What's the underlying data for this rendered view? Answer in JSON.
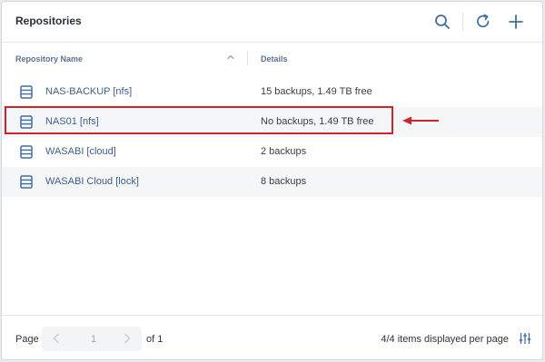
{
  "header": {
    "title": "Repositories",
    "actions": [
      "search-icon",
      "refresh-icon",
      "add-icon"
    ]
  },
  "columns": {
    "name": "Repository Name",
    "details": "Details",
    "sort_icon": "chevron-up-icon"
  },
  "rows": [
    {
      "icon": "database-icon",
      "name": "NAS-BACKUP [nfs]",
      "details": "15 backups, 1.49 TB free"
    },
    {
      "icon": "database-icon",
      "name": "NAS01 [nfs]",
      "details": "No backups, 1.49 TB free"
    },
    {
      "icon": "database-icon",
      "name": "WASABI [cloud]",
      "details": "2 backups"
    },
    {
      "icon": "database-icon",
      "name": "WASABI Cloud [lock]",
      "details": "8 backups"
    }
  ],
  "annotation": {
    "highlight_color": "#d0242b",
    "arrow_icon": "arrow-left-icon"
  },
  "footer": {
    "page_label": "Page",
    "current_page": "1",
    "of_label": "of 1",
    "items_info": "4/4 items displayed per page",
    "settings_icon": "sliders-icon"
  },
  "colors": {
    "link": "#3d5f8a",
    "header_text": "#5a7291",
    "icon": "#3f6ea3"
  }
}
